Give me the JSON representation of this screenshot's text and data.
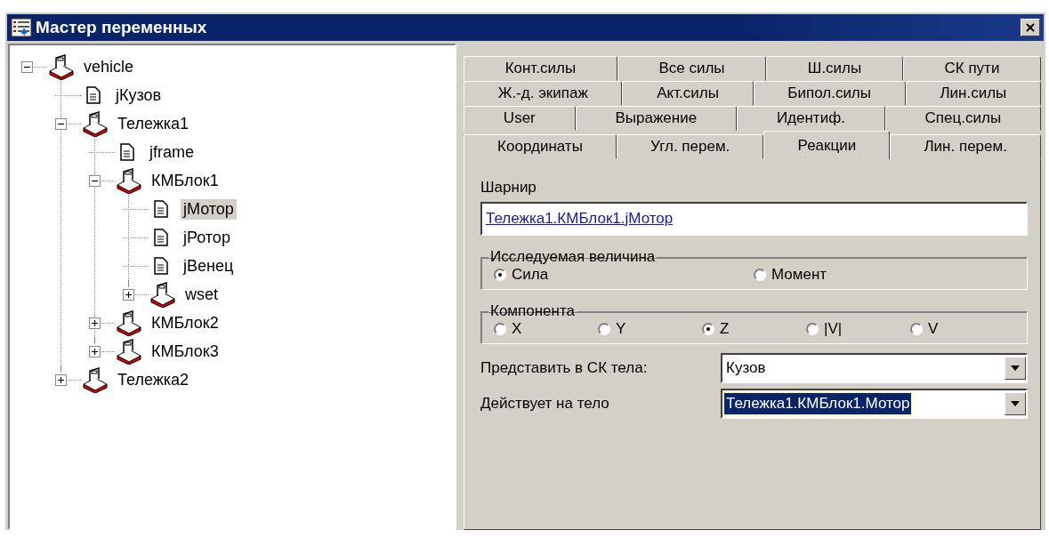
{
  "window": {
    "title": "Мастер переменных"
  },
  "tree": [
    {
      "label": "vehicle",
      "kind": "group",
      "expanded": true,
      "selected": false,
      "children": [
        {
          "label": "jКузов",
          "kind": "joint",
          "selected": false
        },
        {
          "label": "Тележка1",
          "kind": "group",
          "expanded": true,
          "selected": false,
          "children": [
            {
              "label": "jframe",
              "kind": "joint",
              "selected": false
            },
            {
              "label": "КМБлок1",
              "kind": "group",
              "expanded": true,
              "selected": false,
              "children": [
                {
                  "label": "jМотор",
                  "kind": "joint",
                  "selected": true
                },
                {
                  "label": "jРотор",
                  "kind": "joint",
                  "selected": false
                },
                {
                  "label": "jВенец",
                  "kind": "joint",
                  "selected": false
                },
                {
                  "label": "wset",
                  "kind": "group",
                  "expanded": false,
                  "selected": false
                }
              ]
            },
            {
              "label": "КМБлок2",
              "kind": "group",
              "expanded": false,
              "selected": false
            },
            {
              "label": "КМБлок3",
              "kind": "group",
              "expanded": false,
              "selected": false
            }
          ]
        },
        {
          "label": "Тележка2",
          "kind": "group",
          "expanded": false,
          "selected": false
        }
      ]
    }
  ],
  "tab_rows": [
    [
      {
        "label": "Конт.силы",
        "selected": false
      },
      {
        "label": "Все силы",
        "selected": false
      },
      {
        "label": "Ш.силы",
        "selected": false
      },
      {
        "label": "СК пути",
        "selected": false
      }
    ],
    [
      {
        "label": "Ж.-д. экипаж",
        "selected": false
      },
      {
        "label": "Акт.силы",
        "selected": false
      },
      {
        "label": "Бипол.силы",
        "selected": false
      },
      {
        "label": "Лин.силы",
        "selected": false
      }
    ],
    [
      {
        "label": "User",
        "selected": false
      },
      {
        "label": "Выражение",
        "selected": false
      },
      {
        "label": "Идентиф.",
        "selected": false
      },
      {
        "label": "Спец.силы",
        "selected": false
      }
    ],
    [
      {
        "label": "Координаты",
        "selected": false
      },
      {
        "label": "Угл. перем.",
        "selected": false
      },
      {
        "label": "Реакции",
        "selected": true
      },
      {
        "label": "Лин. перем.",
        "selected": false
      }
    ]
  ],
  "joint": {
    "label": "Шарнир",
    "value": "Тележка1.КМБлок1.jМотор"
  },
  "quantity": {
    "title": "Исследуемая величина",
    "options": [
      {
        "label": "Сила",
        "selected": true
      },
      {
        "label": "Момент",
        "selected": false
      }
    ]
  },
  "component": {
    "title": "Компонента",
    "options": [
      {
        "label": "X",
        "selected": false
      },
      {
        "label": "Y",
        "selected": false
      },
      {
        "label": "Z",
        "selected": true
      },
      {
        "label": "|V|",
        "selected": false
      },
      {
        "label": "V",
        "selected": false
      }
    ]
  },
  "body_frame": {
    "label": "Представить в СК тела:",
    "value": "Кузов",
    "highlighted": false
  },
  "acts_on": {
    "label": "Действует на тело",
    "value": "Тележка1.КМБлок1.Мотор",
    "highlighted": true
  }
}
